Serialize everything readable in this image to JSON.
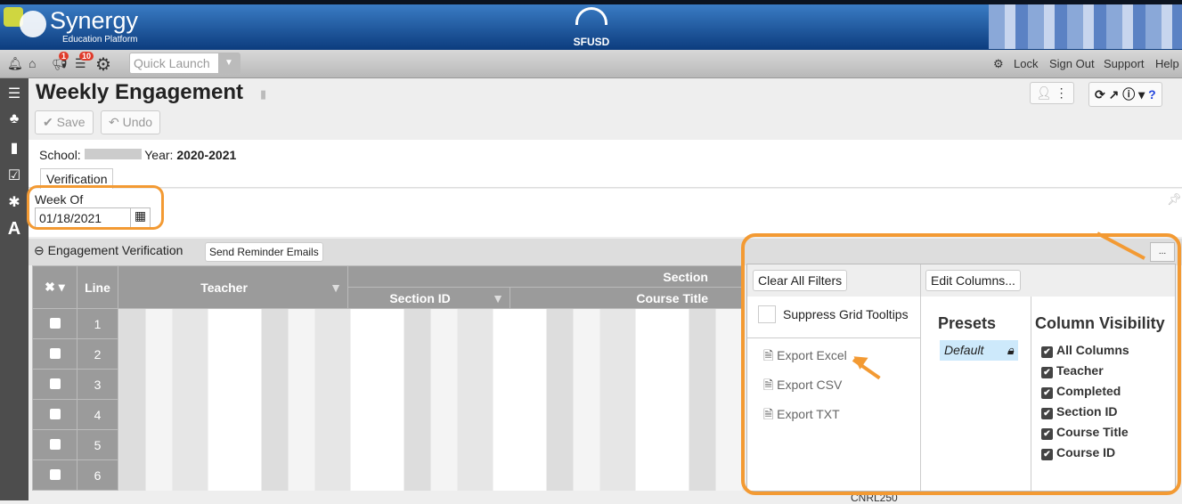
{
  "header": {
    "logo": "Synergy",
    "logo_sub": "Education Platform",
    "district": "SFUSD"
  },
  "toolbar": {
    "notif_badge": "1",
    "list_badge": "10",
    "quick_launch_placeholder": "Quick Launch",
    "links": [
      "Lock",
      "Sign Out",
      "Support",
      "Help"
    ]
  },
  "page": {
    "title": "Weekly Engagement",
    "save": "Save",
    "undo": "Undo",
    "school_label": "School:",
    "year_label": "Year:",
    "year": "2020-2021",
    "tab": "Verification",
    "week_label": "Week Of",
    "week_value": "01/18/2021"
  },
  "grid": {
    "title": "Engagement Verification",
    "reminder_btn": "Send Reminder Emails",
    "headers": {
      "line": "Line",
      "teacher": "Teacher",
      "section": "Section",
      "section_id": "Section ID",
      "course_title": "Course Title"
    },
    "rows": [
      "1",
      "2",
      "3",
      "4",
      "5",
      "6"
    ],
    "partial_cell": "CNRL250"
  },
  "popup": {
    "more_btn": "...",
    "clear_filters": "Clear All Filters",
    "edit_columns": "Edit Columns...",
    "suppress": "Suppress Grid Tooltips",
    "exports": [
      "Export Excel",
      "Export CSV",
      "Export TXT"
    ],
    "presets_title": "Presets",
    "preset_default": "Default",
    "visibility_title": "Column Visibility",
    "columns": [
      "All Columns",
      "Teacher",
      "Completed",
      "Section ID",
      "Course Title",
      "Course ID"
    ]
  },
  "colors": {
    "accent": "#f39a33",
    "banner": "#0c3c7e"
  }
}
